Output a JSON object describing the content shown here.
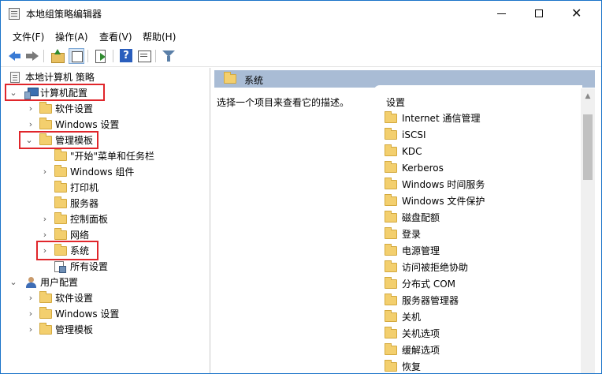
{
  "window": {
    "title": "本地组策略编辑器",
    "controls": {
      "minimize": "minimize",
      "maximize": "maximize",
      "close": "✕"
    }
  },
  "menu": {
    "items": [
      "文件(F)",
      "操作(A)",
      "查看(V)",
      "帮助(H)"
    ]
  },
  "toolbar": {
    "icons": [
      "back-arrow-icon",
      "forward-arrow-icon",
      "up-folder-icon",
      "show-tree-icon",
      "export-list-icon",
      "help-icon",
      "properties-icon",
      "filter-icon"
    ]
  },
  "tree": {
    "root": "本地计算机 策略",
    "computer_config": "计算机配置",
    "cc_software": "软件设置",
    "cc_windows": "Windows 设置",
    "admin_templates": "管理模板",
    "start_menu": "\"开始\"菜单和任务栏",
    "windows_components": "Windows 组件",
    "printers": "打印机",
    "servers": "服务器",
    "control_panel": "控制面板",
    "network": "网络",
    "system": "系统",
    "all_settings": "所有设置",
    "user_config": "用户配置",
    "uc_software": "软件设置",
    "uc_windows": "Windows 设置",
    "uc_admin_templates": "管理模板"
  },
  "right": {
    "header": "系统",
    "description": "选择一个项目来查看它的描述。",
    "list_header": "设置",
    "items": [
      "Internet 通信管理",
      "iSCSI",
      "KDC",
      "Kerberos",
      "Windows 时间服务",
      "Windows 文件保护",
      "磁盘配额",
      "登录",
      "电源管理",
      "访问被拒绝协助",
      "分布式 COM",
      "服务器管理器",
      "关机",
      "关机选项",
      "缓解选项",
      "恢复"
    ]
  },
  "colors": {
    "highlight_box": "#e0262b",
    "header_bar": "#a9bcd5",
    "folder": "#f3cf6e",
    "window_border": "#1a73c9"
  }
}
